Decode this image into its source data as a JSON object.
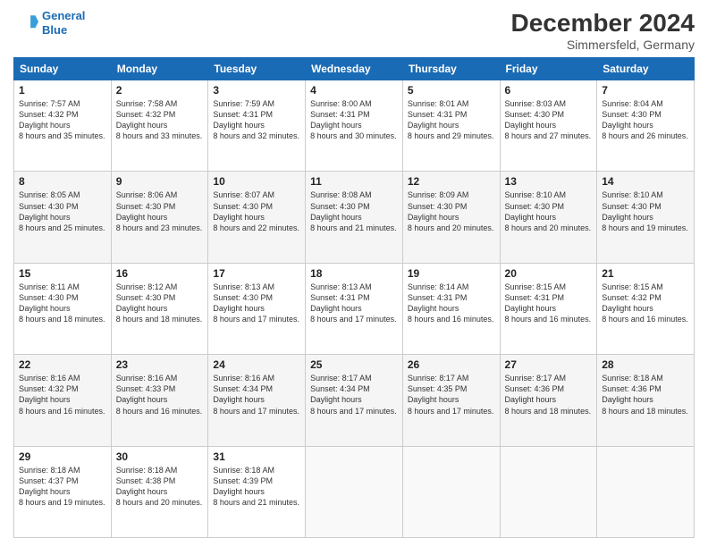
{
  "header": {
    "logo_line1": "General",
    "logo_line2": "Blue",
    "month_title": "December 2024",
    "location": "Simmersfeld, Germany"
  },
  "weekdays": [
    "Sunday",
    "Monday",
    "Tuesday",
    "Wednesday",
    "Thursday",
    "Friday",
    "Saturday"
  ],
  "weeks": [
    [
      {
        "day": "1",
        "sunrise": "7:57 AM",
        "sunset": "4:32 PM",
        "daylight": "8 hours and 35 minutes."
      },
      {
        "day": "2",
        "sunrise": "7:58 AM",
        "sunset": "4:32 PM",
        "daylight": "8 hours and 33 minutes."
      },
      {
        "day": "3",
        "sunrise": "7:59 AM",
        "sunset": "4:31 PM",
        "daylight": "8 hours and 32 minutes."
      },
      {
        "day": "4",
        "sunrise": "8:00 AM",
        "sunset": "4:31 PM",
        "daylight": "8 hours and 30 minutes."
      },
      {
        "day": "5",
        "sunrise": "8:01 AM",
        "sunset": "4:31 PM",
        "daylight": "8 hours and 29 minutes."
      },
      {
        "day": "6",
        "sunrise": "8:03 AM",
        "sunset": "4:30 PM",
        "daylight": "8 hours and 27 minutes."
      },
      {
        "day": "7",
        "sunrise": "8:04 AM",
        "sunset": "4:30 PM",
        "daylight": "8 hours and 26 minutes."
      }
    ],
    [
      {
        "day": "8",
        "sunrise": "8:05 AM",
        "sunset": "4:30 PM",
        "daylight": "8 hours and 25 minutes."
      },
      {
        "day": "9",
        "sunrise": "8:06 AM",
        "sunset": "4:30 PM",
        "daylight": "8 hours and 23 minutes."
      },
      {
        "day": "10",
        "sunrise": "8:07 AM",
        "sunset": "4:30 PM",
        "daylight": "8 hours and 22 minutes."
      },
      {
        "day": "11",
        "sunrise": "8:08 AM",
        "sunset": "4:30 PM",
        "daylight": "8 hours and 21 minutes."
      },
      {
        "day": "12",
        "sunrise": "8:09 AM",
        "sunset": "4:30 PM",
        "daylight": "8 hours and 20 minutes."
      },
      {
        "day": "13",
        "sunrise": "8:10 AM",
        "sunset": "4:30 PM",
        "daylight": "8 hours and 20 minutes."
      },
      {
        "day": "14",
        "sunrise": "8:10 AM",
        "sunset": "4:30 PM",
        "daylight": "8 hours and 19 minutes."
      }
    ],
    [
      {
        "day": "15",
        "sunrise": "8:11 AM",
        "sunset": "4:30 PM",
        "daylight": "8 hours and 18 minutes."
      },
      {
        "day": "16",
        "sunrise": "8:12 AM",
        "sunset": "4:30 PM",
        "daylight": "8 hours and 18 minutes."
      },
      {
        "day": "17",
        "sunrise": "8:13 AM",
        "sunset": "4:30 PM",
        "daylight": "8 hours and 17 minutes."
      },
      {
        "day": "18",
        "sunrise": "8:13 AM",
        "sunset": "4:31 PM",
        "daylight": "8 hours and 17 minutes."
      },
      {
        "day": "19",
        "sunrise": "8:14 AM",
        "sunset": "4:31 PM",
        "daylight": "8 hours and 16 minutes."
      },
      {
        "day": "20",
        "sunrise": "8:15 AM",
        "sunset": "4:31 PM",
        "daylight": "8 hours and 16 minutes."
      },
      {
        "day": "21",
        "sunrise": "8:15 AM",
        "sunset": "4:32 PM",
        "daylight": "8 hours and 16 minutes."
      }
    ],
    [
      {
        "day": "22",
        "sunrise": "8:16 AM",
        "sunset": "4:32 PM",
        "daylight": "8 hours and 16 minutes."
      },
      {
        "day": "23",
        "sunrise": "8:16 AM",
        "sunset": "4:33 PM",
        "daylight": "8 hours and 16 minutes."
      },
      {
        "day": "24",
        "sunrise": "8:16 AM",
        "sunset": "4:34 PM",
        "daylight": "8 hours and 17 minutes."
      },
      {
        "day": "25",
        "sunrise": "8:17 AM",
        "sunset": "4:34 PM",
        "daylight": "8 hours and 17 minutes."
      },
      {
        "day": "26",
        "sunrise": "8:17 AM",
        "sunset": "4:35 PM",
        "daylight": "8 hours and 17 minutes."
      },
      {
        "day": "27",
        "sunrise": "8:17 AM",
        "sunset": "4:36 PM",
        "daylight": "8 hours and 18 minutes."
      },
      {
        "day": "28",
        "sunrise": "8:18 AM",
        "sunset": "4:36 PM",
        "daylight": "8 hours and 18 minutes."
      }
    ],
    [
      {
        "day": "29",
        "sunrise": "8:18 AM",
        "sunset": "4:37 PM",
        "daylight": "8 hours and 19 minutes."
      },
      {
        "day": "30",
        "sunrise": "8:18 AM",
        "sunset": "4:38 PM",
        "daylight": "8 hours and 20 minutes."
      },
      {
        "day": "31",
        "sunrise": "8:18 AM",
        "sunset": "4:39 PM",
        "daylight": "8 hours and 21 minutes."
      },
      null,
      null,
      null,
      null
    ]
  ]
}
